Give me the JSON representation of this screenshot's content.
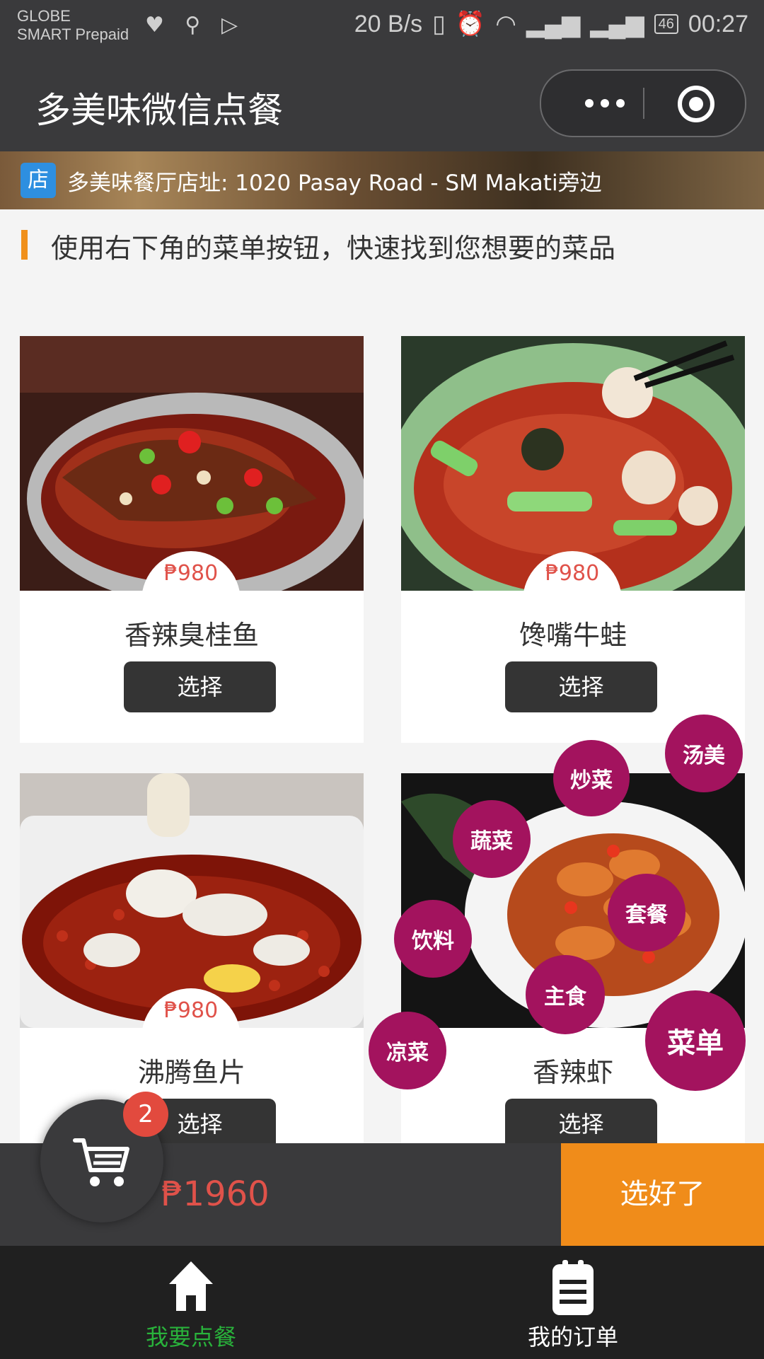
{
  "status_bar": {
    "carrier_line1": "GLOBE",
    "carrier_line2": "SMART Prepaid",
    "speed": "20 B/s",
    "battery": "46",
    "time": "00:27"
  },
  "header": {
    "title": "多美味微信点餐",
    "more_icon": "ellipsis-icon",
    "close_icon": "target-icon"
  },
  "banner": {
    "badge": "店",
    "address": "多美味餐厅店址: 1020 Pasay Road - SM Makati旁边"
  },
  "hint": "使用右下角的菜单按钮，快速找到您想要的菜品",
  "dishes": [
    {
      "price": "₱980",
      "name": "香辣臭桂鱼",
      "select_label": "选择"
    },
    {
      "price": "₱980",
      "name": "馋嘴牛蛙",
      "select_label": "选择"
    },
    {
      "price": "₱980",
      "name": "沸腾鱼片",
      "select_label": "选择"
    },
    {
      "price": "",
      "name": "香辣虾",
      "select_label": "选择"
    }
  ],
  "categories": {
    "menu": "菜单",
    "items": [
      "汤美",
      "炒菜",
      "蔬菜",
      "套餐",
      "饮料",
      "主食",
      "凉菜"
    ]
  },
  "cart": {
    "count": "2",
    "total": "₱1960",
    "done_label": "选好了"
  },
  "tabbar": {
    "tabs": [
      {
        "label": "我要点餐",
        "icon": "home-icon",
        "active": true
      },
      {
        "label": "我的订单",
        "icon": "orders-icon",
        "active": false
      }
    ],
    "active_color": "#29b23b"
  },
  "colors": {
    "accent_orange": "#f08c1a",
    "price_red": "#e0524a",
    "bubble_purple": "#a3135e"
  }
}
